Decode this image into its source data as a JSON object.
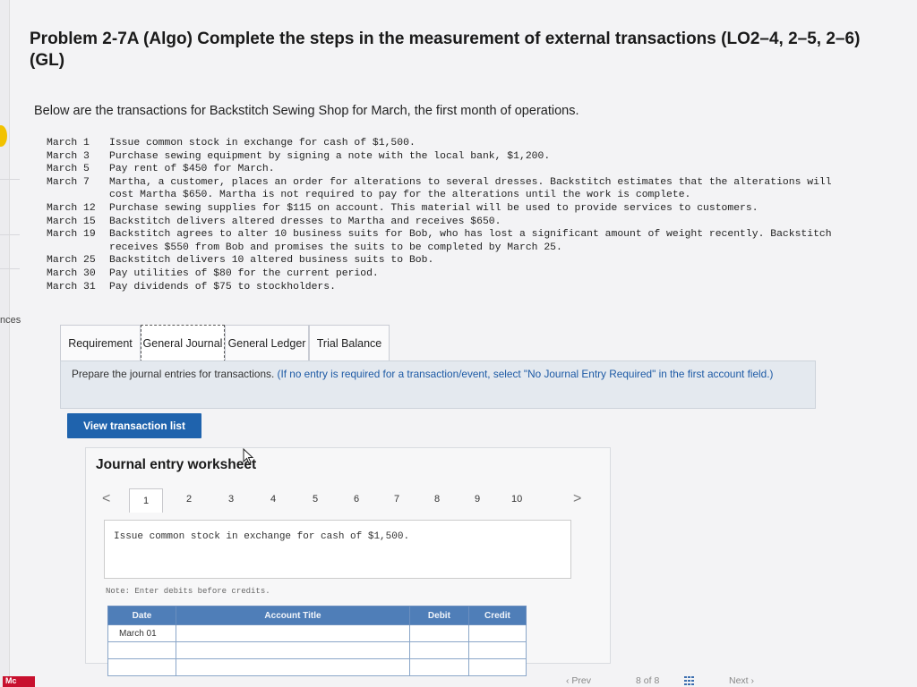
{
  "title": "Problem 2-7A (Algo) Complete the steps in the measurement of external transactions (LO2–4, 2–5, 2–6) (GL)",
  "intro": "Below are the transactions for Backstitch Sewing Shop for March, the first month of operations.",
  "side_label": "nces",
  "transactions": [
    {
      "date": "March 1 ",
      "text": "Issue common stock in exchange for cash of $1,500."
    },
    {
      "date": "March 3 ",
      "text": "Purchase sewing equipment by signing a note with the local bank, $1,200."
    },
    {
      "date": "March 5 ",
      "text": "Pay rent of $450 for March."
    },
    {
      "date": "March 7 ",
      "text": "Martha, a customer, places an order for alterations to several dresses. Backstitch estimates that the alterations will cost Martha $650. Martha is not required to pay for the alterations until the work is complete."
    },
    {
      "date": "March 12",
      "text": "Purchase sewing supplies for $115 on account. This material will be used to provide services to customers."
    },
    {
      "date": "March 15",
      "text": "Backstitch delivers altered dresses to Martha and receives $650."
    },
    {
      "date": "March 19",
      "text": "Backstitch agrees to alter 10 business suits for Bob, who has lost a significant amount of weight recently. Backstitch receives $550 from Bob and promises the suits to be completed by March 25."
    },
    {
      "date": "March 25",
      "text": "Backstitch delivers 10 altered business suits to Bob."
    },
    {
      "date": "March 30",
      "text": "Pay utilities of $80 for the current period."
    },
    {
      "date": "March 31",
      "text": "Pay dividends of $75 to stockholders."
    }
  ],
  "tabs": [
    {
      "label": "Requirement"
    },
    {
      "label": "General Journal"
    },
    {
      "label": "General Ledger"
    },
    {
      "label": "Trial Balance"
    }
  ],
  "instruction": {
    "main": "Prepare the journal entries for transactions.",
    "paren": "(If no entry is required for a transaction/event, select \"No Journal Entry Required\" in the first account field.)"
  },
  "view_button": "View transaction list",
  "worksheet": {
    "title": "Journal entry worksheet",
    "pages": [
      "1",
      "2",
      "3",
      "4",
      "5",
      "6",
      "7",
      "8",
      "9",
      "10"
    ],
    "prev_arrow": "<",
    "next_arrow": ">",
    "description": "Issue common stock in exchange for cash of $1,500.",
    "note": "Note: Enter debits before credits.",
    "columns": {
      "date": "Date",
      "account": "Account Title",
      "debit": "Debit",
      "credit": "Credit"
    },
    "rows": [
      {
        "date": "March 01"
      },
      {
        "date": ""
      },
      {
        "date": ""
      }
    ]
  },
  "footer": {
    "logo": "Mc",
    "prev": "Prev",
    "page_current": "8",
    "page_of": "of",
    "page_total": "8",
    "next": "Next"
  },
  "colors": {
    "primary_button": "#1f63ad",
    "table_header": "#4f7eb8",
    "instruction_bg": "#e4e9ef",
    "accent_yellow": "#f2c200",
    "brand_red": "#c8102e"
  }
}
